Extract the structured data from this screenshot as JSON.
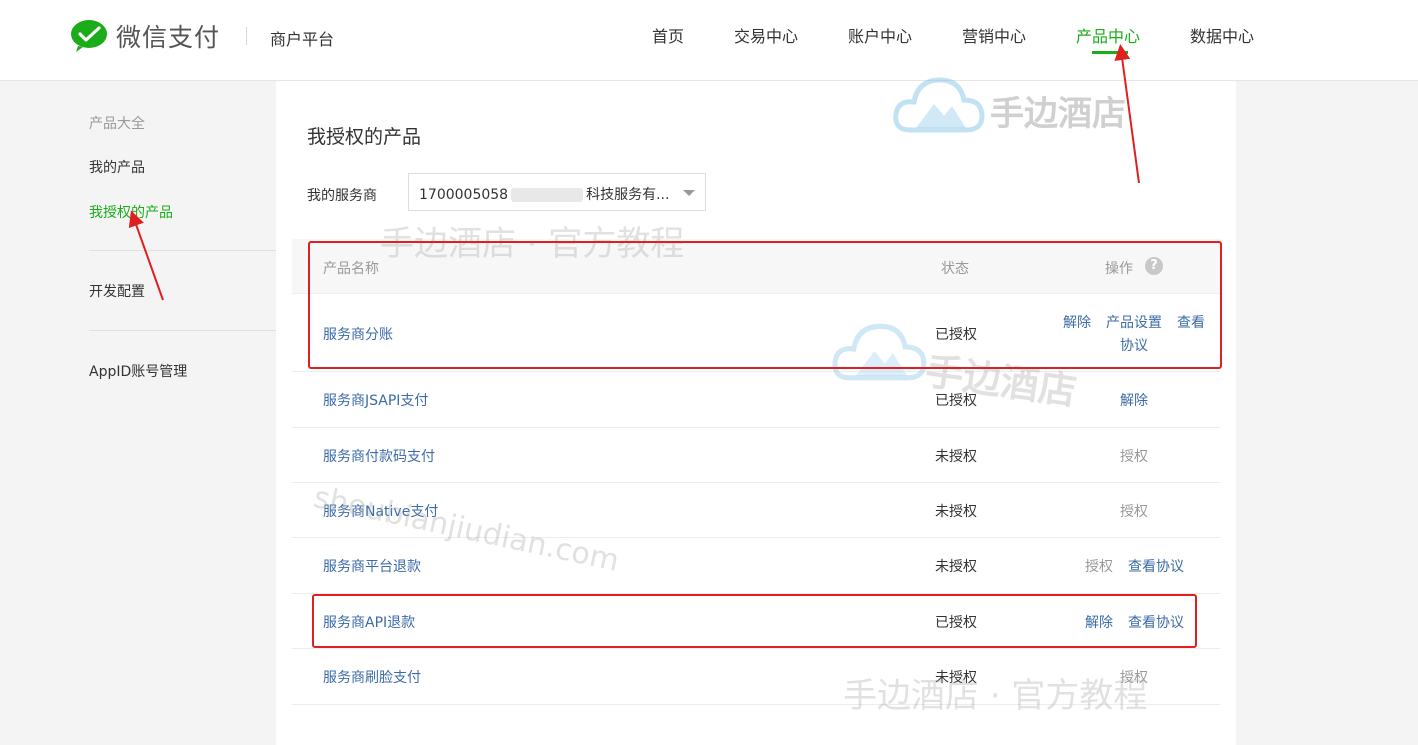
{
  "header": {
    "brand": "微信支付",
    "platform": "商户平台",
    "nav": [
      {
        "label": "首页",
        "active": false
      },
      {
        "label": "交易中心",
        "active": false
      },
      {
        "label": "账户中心",
        "active": false
      },
      {
        "label": "营销中心",
        "active": false
      },
      {
        "label": "产品中心",
        "active": true
      },
      {
        "label": "数据中心",
        "active": false
      }
    ],
    "accent_color": "#1aad19"
  },
  "sidebar": {
    "heading": "产品大全",
    "items": [
      {
        "label": "我的产品",
        "active": false
      },
      {
        "label": "我授权的产品",
        "active": true
      },
      {
        "label": "开发配置",
        "active": false
      },
      {
        "label": "AppID账号管理",
        "active": false
      }
    ]
  },
  "main": {
    "title": "我授权的产品",
    "service_provider": {
      "label": "我的服务商",
      "value_prefix": "1700005058",
      "value_suffix": "科技服务有..."
    },
    "table": {
      "columns": [
        "产品名称",
        "状态",
        "操作"
      ],
      "rows": [
        {
          "name": "服务商分账",
          "status": "已授权",
          "actions": [
            "解除",
            "产品设置",
            "查看",
            "协议"
          ]
        },
        {
          "name": "服务商JSAPI支付",
          "status": "已授权",
          "actions": [
            "解除"
          ]
        },
        {
          "name": "服务商付款码支付",
          "status": "未授权",
          "actions": [
            "授权"
          ]
        },
        {
          "name": "服务商Native支付",
          "status": "未授权",
          "actions": [
            "授权"
          ]
        },
        {
          "name": "服务商平台退款",
          "status": "未授权",
          "actions": [
            "授权",
            "查看协议"
          ]
        },
        {
          "name": "服务商API退款",
          "status": "已授权",
          "actions": [
            "解除",
            "查看协议"
          ]
        },
        {
          "name": "服务商刷脸支付",
          "status": "未授权",
          "actions": [
            "授权"
          ]
        }
      ]
    }
  },
  "watermarks": {
    "brand": "手边酒店",
    "tutorial": "手边酒店 · 官方教程",
    "url": "shoubianjiudian.com"
  },
  "colors": {
    "link": "#3c6ba8",
    "muted": "#999999",
    "highlight": "#e02020"
  }
}
